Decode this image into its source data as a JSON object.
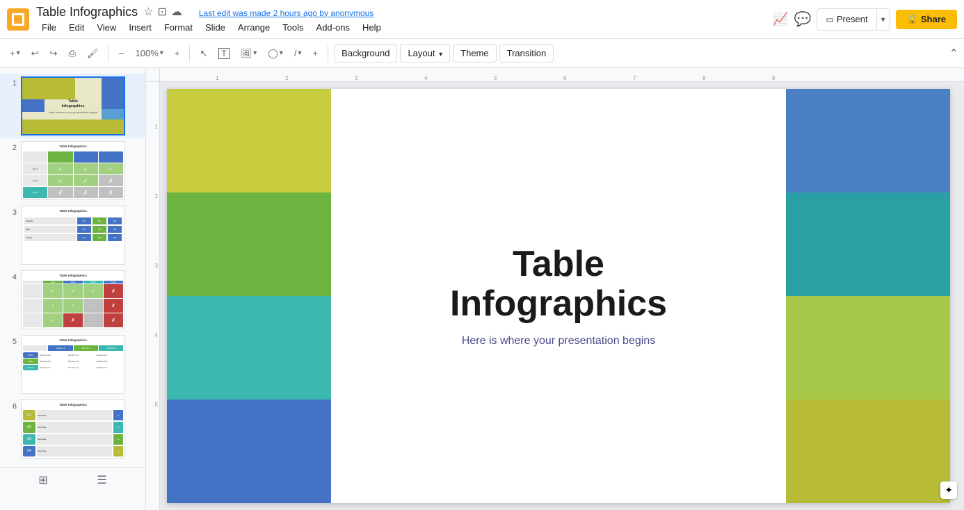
{
  "app": {
    "icon_color": "#f9a825",
    "title": "Table Infographics",
    "last_edit": "Last edit was made 2 hours ago by anonymous"
  },
  "title_icons": {
    "star": "☆",
    "folder": "⊡",
    "cloud": "☁"
  },
  "menu": {
    "items": [
      "File",
      "Edit",
      "View",
      "Insert",
      "Format",
      "Slide",
      "Arrange",
      "Tools",
      "Add-ons",
      "Help"
    ]
  },
  "toolbar": {
    "add_label": "+",
    "undo_label": "↩",
    "redo_label": "↪",
    "print_label": "⎙",
    "cursor_label": "↗",
    "background_label": "Background",
    "layout_label": "Layout",
    "layout_arrow": "▾",
    "theme_label": "Theme",
    "transition_label": "Transition",
    "zoom_label": "100%",
    "zoom_arrow": "▾"
  },
  "present": {
    "label": "Present",
    "arrow": "▾",
    "monitor_icon": "⬜"
  },
  "share": {
    "label": "Share",
    "lock_icon": "🔒"
  },
  "slides": [
    {
      "num": "1",
      "active": true
    },
    {
      "num": "2",
      "active": false
    },
    {
      "num": "3",
      "active": false
    },
    {
      "num": "4",
      "active": false
    },
    {
      "num": "5",
      "active": false
    },
    {
      "num": "6",
      "active": false
    }
  ],
  "main_slide": {
    "title": "Table",
    "title_line2": "Infographics",
    "subtitle": "Here is where your presentation begins"
  },
  "colors": {
    "yellow_green": "#c8cc3f",
    "medium_green": "#6db33f",
    "teal": "#3db8b0",
    "blue": "#4472c4",
    "dark_teal": "#2aa0a4",
    "light_green": "#a8c84a",
    "olive": "#b8bb36",
    "steel_blue": "#4a7fc1"
  },
  "nav": {
    "grid_icon": "⊞",
    "list_icon": "☰"
  }
}
